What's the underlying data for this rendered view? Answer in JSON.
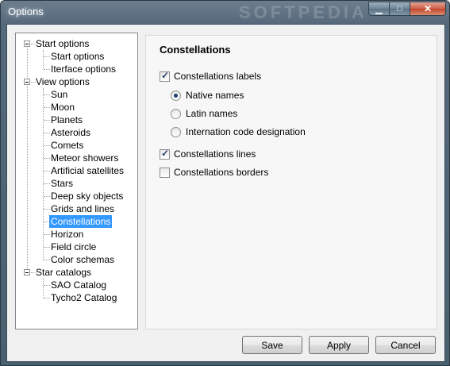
{
  "window": {
    "title": "Options",
    "watermark": "SOFTPEDIA",
    "minimize_glyph": "▁",
    "maximize_glyph": "□",
    "close_glyph": "✕"
  },
  "tree": {
    "start_options": {
      "label": "Start options",
      "children": [
        "Start options",
        "Iterface options"
      ]
    },
    "view_options": {
      "label": "View options",
      "children": [
        "Sun",
        "Moon",
        "Planets",
        "Asteroids",
        "Comets",
        "Meteor showers",
        "Artificial satellites",
        "Stars",
        "Deep sky objects",
        "Grids and lines",
        "Constellations",
        "Horizon",
        "Field circle",
        "Color schemas"
      ]
    },
    "star_catalogs": {
      "label": "Star catalogs",
      "children": [
        "SAO Catalog",
        "Tycho2 Catalog"
      ]
    },
    "selected": "Constellations"
  },
  "panel": {
    "heading": "Constellations",
    "labels_checkbox": {
      "label": "Constellations labels",
      "checked": true
    },
    "radios": [
      {
        "label": "Native names",
        "selected": true
      },
      {
        "label": "Latin names",
        "selected": false
      },
      {
        "label": "Internation code designation",
        "selected": false
      }
    ],
    "lines_checkbox": {
      "label": "Constellations lines",
      "checked": true
    },
    "borders_checkbox": {
      "label": "Constellations borders",
      "checked": false
    }
  },
  "buttons": {
    "save": "Save",
    "apply": "Apply",
    "cancel": "Cancel"
  }
}
